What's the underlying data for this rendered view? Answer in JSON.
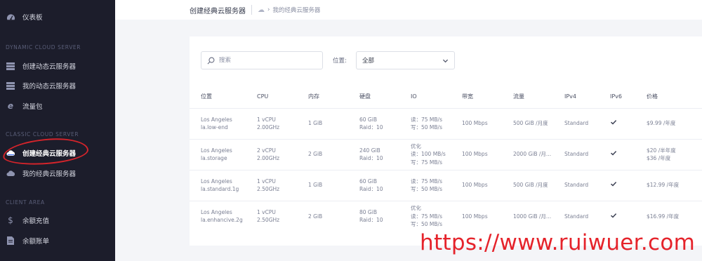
{
  "sidebar": {
    "dashboard": "仪表板",
    "section_dynamic": "DYNAMIC CLOUD SERVER",
    "create_dynamic": "创建动态云服务器",
    "my_dynamic": "我的动态云服务器",
    "traffic_pack": "流量包",
    "section_classic": "CLASSIC CLOUD SERVER",
    "create_classic": "创建经典云服务器",
    "my_classic": "我的经典云服务器",
    "section_client": "CLIENT AREA",
    "balance_recharge": "余额充值",
    "balance_bill": "余额账单"
  },
  "header": {
    "title": "创建经典云服务器",
    "breadcrumb": "我的经典云服务器"
  },
  "filters": {
    "search_placeholder": "搜索",
    "location_label": "位置:",
    "location_selected": "全部"
  },
  "table": {
    "columns": [
      "位置",
      "CPU",
      "内存",
      "硬盘",
      "IO",
      "带宽",
      "流量",
      "IPv4",
      "IPv6",
      "价格"
    ],
    "rows": [
      {
        "loc1": "Los Angeles",
        "loc2": "la.low-end",
        "cpu1": "1 vCPU",
        "cpu2": "2.00GHz",
        "mem": "1 GiB",
        "disk1": "60 GiB",
        "disk2": "Raid：10",
        "io1": "",
        "io2": "读：75 MB/s",
        "io3": "写：50 MB/s",
        "bw": "100 Mbps",
        "traffic": "500 GiB /月度",
        "ipv4": "Standard",
        "ipv6": true,
        "price1": "$9.99 /年度",
        "price2": ""
      },
      {
        "loc1": "Los Angeles",
        "loc2": "la.storage",
        "cpu1": "2 vCPU",
        "cpu2": "2.00GHz",
        "mem": "2 GiB",
        "disk1": "240 GiB",
        "disk2": "Raid：10",
        "io1": "优化",
        "io2": "读：100 MB/s",
        "io3": "写：75 MB/s",
        "bw": "100 Mbps",
        "traffic": "2000 GiB /月...",
        "ipv4": "Standard",
        "ipv6": true,
        "price1": "$20 /半年度",
        "price2": "$36 /年度"
      },
      {
        "loc1": "Los Angeles",
        "loc2": "la.standard.1g",
        "cpu1": "1 vCPU",
        "cpu2": "2.50GHz",
        "mem": "1 GiB",
        "disk1": "60 GiB",
        "disk2": "Raid：10",
        "io1": "",
        "io2": "读：75 MB/s",
        "io3": "写：50 MB/s",
        "bw": "100 Mbps",
        "traffic": "500 GiB /月度",
        "ipv4": "Standard",
        "ipv6": true,
        "price1": "$12.99 /年度",
        "price2": ""
      },
      {
        "loc1": "Los Angeles",
        "loc2": "la.enhancive.2g",
        "cpu1": "1 vCPU",
        "cpu2": "2.50GHz",
        "mem": "2 GiB",
        "disk1": "80 GiB",
        "disk2": "Raid：10",
        "io1": "优化",
        "io2": "读：75 MB/s",
        "io3": "写：50 MB/s",
        "bw": "100 Mbps",
        "traffic": "1000 GiB /月...",
        "ipv4": "Standard",
        "ipv6": true,
        "price1": "$16.99 /年度",
        "price2": ""
      }
    ]
  },
  "watermark": "https://www.ruiwuer.com",
  "colors": {
    "sidebar_bg": "#1c1d2b",
    "annotation": "#d4242b",
    "watermark": "#e5232b"
  }
}
